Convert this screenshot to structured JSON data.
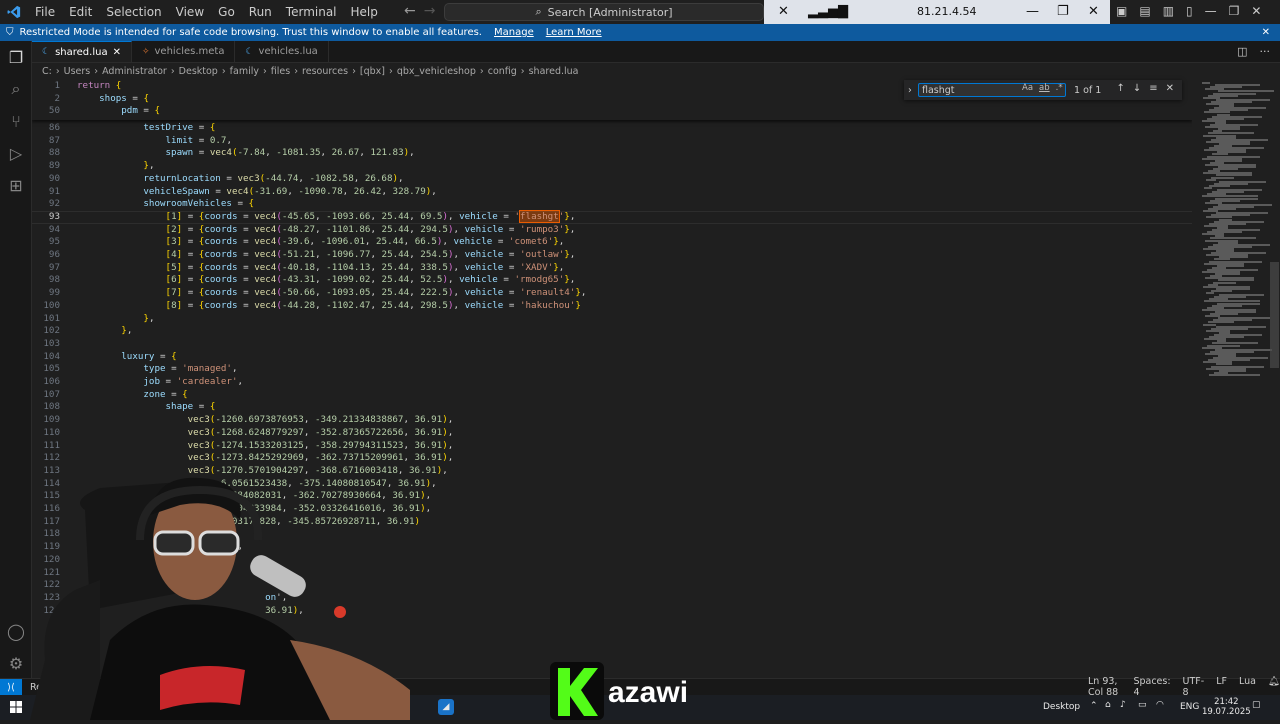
{
  "menu": [
    "File",
    "Edit",
    "Selection",
    "View",
    "Go",
    "Run",
    "Terminal",
    "Help"
  ],
  "search_placeholder": "Search [Administrator]",
  "remote": {
    "ip": "81.21.4.54"
  },
  "restricted": {
    "message": "Restricted Mode is intended for safe code browsing. Trust this window to enable all features.",
    "manage": "Manage",
    "learn_more": "Learn More"
  },
  "tabs": [
    {
      "label": "shared.lua",
      "active": true,
      "icon": "lua-icon"
    },
    {
      "label": "vehicles.meta",
      "active": false,
      "icon": "meta-icon"
    },
    {
      "label": "vehicles.lua",
      "active": false,
      "icon": "lua-icon"
    }
  ],
  "breadcrumb": [
    "C:",
    "Users",
    "Administrator",
    "Desktop",
    "family",
    "files",
    "resources",
    "[qbx]",
    "qbx_vehicleshop",
    "config",
    "shared.lua"
  ],
  "find": {
    "query": "flashgt",
    "result": "1 of 1",
    "match_case": "Aa",
    "whole_word": "ab",
    "regex": ".*"
  },
  "sticky": [
    {
      "n": "1",
      "t": "return {"
    },
    {
      "n": "2",
      "t": "    shops = {"
    },
    {
      "n": "50",
      "t": "        pdm = {"
    }
  ],
  "lines": [
    {
      "n": "86",
      "t": "            testDrive = {"
    },
    {
      "n": "87",
      "t": "                limit = 0.7,"
    },
    {
      "n": "88",
      "t": "                spawn = vec4(-7.84, -1081.35, 26.67, 121.83),"
    },
    {
      "n": "89",
      "t": "            },"
    },
    {
      "n": "90",
      "t": "            returnLocation = vec3(-44.74, -1082.58, 26.68),"
    },
    {
      "n": "91",
      "t": "            vehicleSpawn = vec4(-31.69, -1090.78, 26.42, 328.79),"
    },
    {
      "n": "92",
      "t": "            showroomVehicles = {"
    },
    {
      "n": "93",
      "t": "                [1] = {coords = vec4(-45.65, -1093.66, 25.44, 69.5), vehicle = 'flashgt'},"
    },
    {
      "n": "94",
      "t": "                [2] = {coords = vec4(-48.27, -1101.86, 25.44, 294.5), vehicle = 'rumpo3'},"
    },
    {
      "n": "95",
      "t": "                [3] = {coords = vec4(-39.6, -1096.01, 25.44, 66.5), vehicle = 'comet6'},"
    },
    {
      "n": "96",
      "t": "                [4] = {coords = vec4(-51.21, -1096.77, 25.44, 254.5), vehicle = 'outlaw'},"
    },
    {
      "n": "97",
      "t": "                [5] = {coords = vec4(-40.18, -1104.13, 25.44, 338.5), vehicle = 'XADV'},"
    },
    {
      "n": "98",
      "t": "                [6] = {coords = vec4(-43.31, -1099.02, 25.44, 52.5), vehicle = 'rmodg65'},"
    },
    {
      "n": "99",
      "t": "                [7] = {coords = vec4(-50.66, -1093.05, 25.44, 222.5), vehicle = 'renault4'},"
    },
    {
      "n": "100",
      "t": "                [8] = {coords = vec4(-44.28, -1102.47, 25.44, 298.5), vehicle = 'hakuchou'}"
    },
    {
      "n": "101",
      "t": "            },"
    },
    {
      "n": "102",
      "t": "        },"
    },
    {
      "n": "103",
      "t": ""
    },
    {
      "n": "104",
      "t": "        luxury = {"
    },
    {
      "n": "105",
      "t": "            type = 'managed',"
    },
    {
      "n": "106",
      "t": "            job = 'cardealer',"
    },
    {
      "n": "107",
      "t": "            zone = {"
    },
    {
      "n": "108",
      "t": "                shape = {"
    },
    {
      "n": "109",
      "t": "                    vec3(-1260.6973876953, -349.21334838867, 36.91),"
    },
    {
      "n": "110",
      "t": "                    vec3(-1268.6248779297, -352.87365722656, 36.91),"
    },
    {
      "n": "111",
      "t": "                    vec3(-1274.1533203125, -358.29794311523, 36.91),"
    },
    {
      "n": "112",
      "t": "                    vec3(-1273.8425292969, -362.73715209961, 36.91),"
    },
    {
      "n": "113",
      "t": "                    vec3(-1270.5701904297, -368.6716003418, 36.91),"
    },
    {
      "n": "114",
      "t": "                          6.0561523438, -375.14080810547, 36.91),"
    },
    {
      "n": "115",
      "t": "                           3684082031, -362.70278930664, 36.91),"
    },
    {
      "n": "116",
      "t": "                           8704833984, -352.03326416016, 36.91),"
    },
    {
      "n": "117",
      "t": "                           503173828, -345.85726928711, 36.91)"
    },
    {
      "n": "118",
      "t": ""
    },
    {
      "n": "119",
      "t": "                            ),"
    },
    {
      "n": "120",
      "t": ""
    },
    {
      "n": "121",
      "t": ""
    },
    {
      "n": "122",
      "t": ""
    },
    {
      "n": "123",
      "t": "                                  on',"
    },
    {
      "n": "124",
      "t": "                                  36.91),"
    }
  ],
  "status": {
    "position": "Ln 93, Col 88",
    "spaces": "Spaces: 4",
    "encoding": "UTF-8",
    "eol": "LF",
    "language": "Lua",
    "restricted": "Res"
  },
  "taskbar": {
    "desktop": "Desktop",
    "lang": "ENG",
    "time": "21:42",
    "date": "19.07.2025"
  },
  "overlay": {
    "brand": "azawi"
  }
}
